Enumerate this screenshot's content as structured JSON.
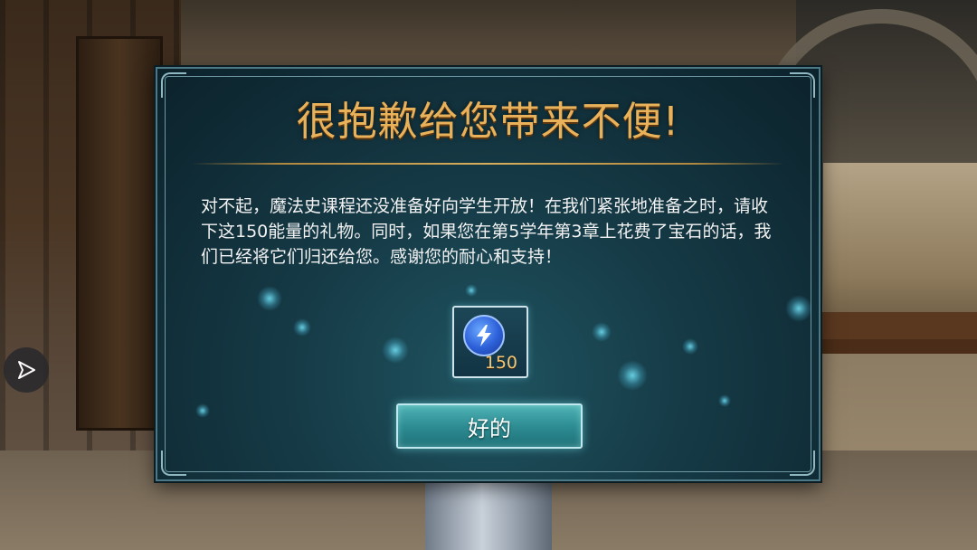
{
  "dialog": {
    "title": "很抱歉给您带来不便!",
    "message": "对不起，魔法史课程还没准备好向学生开放！在我们紧张地准备之时，请收下这150能量的礼物。同时，如果您在第5学年第3章上花费了宝石的话，我们已经将它们归还给您。感谢您的耐心和支持！",
    "reward": {
      "icon": "lightning-energy-icon",
      "amount": "150"
    },
    "confirm_label": "好的"
  },
  "side_button": {
    "icon": "play-triangle-icon"
  },
  "colors": {
    "title_gold": "#e9b25a",
    "panel_teal": "#163c48",
    "button_teal": "#2d8d93",
    "energy_blue": "#2c5fd8",
    "amount_gold": "#f0c878"
  }
}
